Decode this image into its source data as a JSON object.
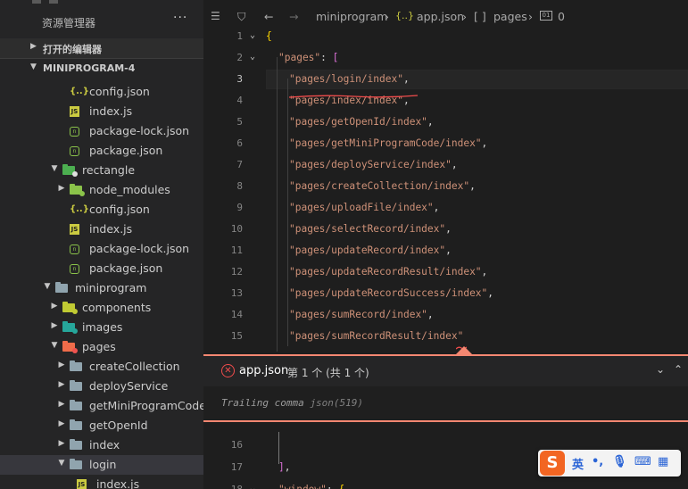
{
  "sidebar": {
    "title": "资源管理器",
    "more": "···",
    "sections": {
      "open_editors": "打开的编辑器",
      "project": "MINIPROGRAM-4"
    },
    "tree": [
      {
        "name": "config.json",
        "type": "json",
        "level": 3
      },
      {
        "name": "index.js",
        "type": "js",
        "level": 3
      },
      {
        "name": "package-lock.json",
        "type": "npm",
        "level": 3
      },
      {
        "name": "package.json",
        "type": "npm",
        "level": 3
      },
      {
        "name": "rectangle",
        "type": "folder-cloud",
        "level": 2,
        "expanded": true
      },
      {
        "name": "node_modules",
        "type": "folder-node",
        "level": 3,
        "expanded": false
      },
      {
        "name": "config.json",
        "type": "json",
        "level": 3
      },
      {
        "name": "index.js",
        "type": "js",
        "level": 3
      },
      {
        "name": "package-lock.json",
        "type": "npm",
        "level": 3
      },
      {
        "name": "package.json",
        "type": "npm",
        "level": 3
      },
      {
        "name": "miniprogram",
        "type": "folder",
        "level": 1,
        "expanded": true
      },
      {
        "name": "components",
        "type": "folder-components",
        "level": 2,
        "expanded": false
      },
      {
        "name": "images",
        "type": "folder-images",
        "level": 2,
        "expanded": false
      },
      {
        "name": "pages",
        "type": "folder-pages",
        "level": 2,
        "expanded": true
      },
      {
        "name": "createCollection",
        "type": "folder",
        "level": 3,
        "expanded": false
      },
      {
        "name": "deployService",
        "type": "folder",
        "level": 3,
        "expanded": false
      },
      {
        "name": "getMiniProgramCode",
        "type": "folder",
        "level": 3,
        "expanded": false
      },
      {
        "name": "getOpenId",
        "type": "folder",
        "level": 3,
        "expanded": false
      },
      {
        "name": "index",
        "type": "folder",
        "level": 3,
        "expanded": false
      },
      {
        "name": "login",
        "type": "folder",
        "level": 3,
        "expanded": true,
        "active": true
      },
      {
        "name": "index.js",
        "type": "js",
        "level": 4
      }
    ]
  },
  "breadcrumb": {
    "folder": "miniprogram",
    "file": "app.json",
    "key": "pages",
    "index": "0",
    "file_icon": "{..}",
    "key_icon": "[ ]"
  },
  "editor": {
    "top_lines": [
      {
        "n": "1",
        "text": "{"
      },
      {
        "n": "2",
        "text": "\"pages\": ["
      },
      {
        "n": "3",
        "text": "\"pages/login/index\",",
        "current": true
      },
      {
        "n": "4",
        "text": "\"pages/index/index\","
      },
      {
        "n": "5",
        "text": "\"pages/getOpenId/index\","
      },
      {
        "n": "6",
        "text": "\"pages/getMiniProgramCode/index\","
      },
      {
        "n": "7",
        "text": "\"pages/deployService/index\","
      },
      {
        "n": "8",
        "text": "\"pages/createCollection/index\","
      },
      {
        "n": "9",
        "text": "\"pages/uploadFile/index\","
      },
      {
        "n": "10",
        "text": "\"pages/selectRecord/index\","
      },
      {
        "n": "11",
        "text": "\"pages/updateRecord/index\","
      },
      {
        "n": "12",
        "text": "\"pages/updateRecordResult/index\","
      },
      {
        "n": "13",
        "text": "\"pages/updateRecordSuccess/index\","
      },
      {
        "n": "14",
        "text": "\"pages/sumRecord/index\","
      },
      {
        "n": "15",
        "text": "\"pages/sumRecordResult/index\""
      }
    ],
    "bottom_lines": [
      {
        "n": "16",
        "text": ""
      },
      {
        "n": "17",
        "text": "],"
      },
      {
        "n": "18",
        "text": "\"window\": {"
      }
    ]
  },
  "problems": {
    "file": "app.json",
    "count": "第 1 个 (共 1 个)",
    "message": "Trailing comma",
    "source": "json(519)"
  },
  "ime": {
    "logo": "S",
    "mode": "英",
    "items": [
      "•,",
      "🎙",
      "⌨",
      "▦"
    ]
  },
  "colors": {
    "string": "#ce9178",
    "error": "#f14c4c",
    "peek_border": "#f48771",
    "brace": "#ffd700",
    "bracket": "#da70d6"
  }
}
